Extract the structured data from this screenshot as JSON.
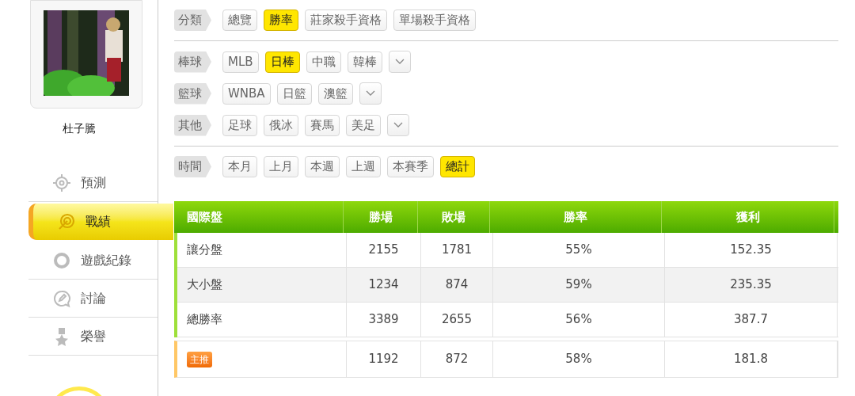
{
  "profile": {
    "name": "杜子騰"
  },
  "menu": [
    {
      "label": "預測",
      "selected": false
    },
    {
      "label": "戰績",
      "selected": true
    },
    {
      "label": "遊戲紀錄",
      "selected": false
    },
    {
      "label": "討論",
      "selected": false
    },
    {
      "label": "榮譽",
      "selected": false
    }
  ],
  "filter_groups": [
    {
      "rows": [
        {
          "label": "分類",
          "has_dropdown": false,
          "options": [
            {
              "label": "總覽",
              "selected": false
            },
            {
              "label": "勝率",
              "selected": true
            },
            {
              "label": "莊家殺手資格",
              "selected": false
            },
            {
              "label": "單場殺手資格",
              "selected": false
            }
          ]
        }
      ]
    },
    {
      "rows": [
        {
          "label": "棒球",
          "has_dropdown": true,
          "options": [
            {
              "label": "MLB",
              "selected": false
            },
            {
              "label": "日棒",
              "selected": true
            },
            {
              "label": "中職",
              "selected": false
            },
            {
              "label": "韓棒",
              "selected": false
            }
          ]
        },
        {
          "label": "籃球",
          "has_dropdown": true,
          "options": [
            {
              "label": "WNBA",
              "selected": false
            },
            {
              "label": "日籃",
              "selected": false
            },
            {
              "label": "澳籃",
              "selected": false
            }
          ]
        },
        {
          "label": "其他",
          "has_dropdown": true,
          "options": [
            {
              "label": "足球",
              "selected": false
            },
            {
              "label": "俄冰",
              "selected": false
            },
            {
              "label": "賽馬",
              "selected": false
            },
            {
              "label": "美足",
              "selected": false
            }
          ]
        }
      ]
    },
    {
      "rows": [
        {
          "label": "時間",
          "has_dropdown": false,
          "options": [
            {
              "label": "本月",
              "selected": false
            },
            {
              "label": "上月",
              "selected": false
            },
            {
              "label": "本週",
              "selected": false
            },
            {
              "label": "上週",
              "selected": false
            },
            {
              "label": "本賽季",
              "selected": false
            },
            {
              "label": "總計",
              "selected": true
            }
          ]
        }
      ]
    }
  ],
  "table": {
    "columns": [
      "國際盤",
      "勝場",
      "敗場",
      "勝率",
      "獲利"
    ],
    "rows": [
      {
        "cells": [
          "讓分盤",
          "2155",
          "1781",
          "55%",
          "152.35"
        ]
      },
      {
        "cells": [
          "大小盤",
          "1234",
          "874",
          "59%",
          "235.35"
        ]
      },
      {
        "cells": [
          "總勝率",
          "3389",
          "2655",
          "56%",
          "387.7"
        ]
      }
    ],
    "featured_row": {
      "badge": "主推",
      "cells": [
        "1192",
        "872",
        "58%",
        "181.8"
      ]
    }
  }
}
